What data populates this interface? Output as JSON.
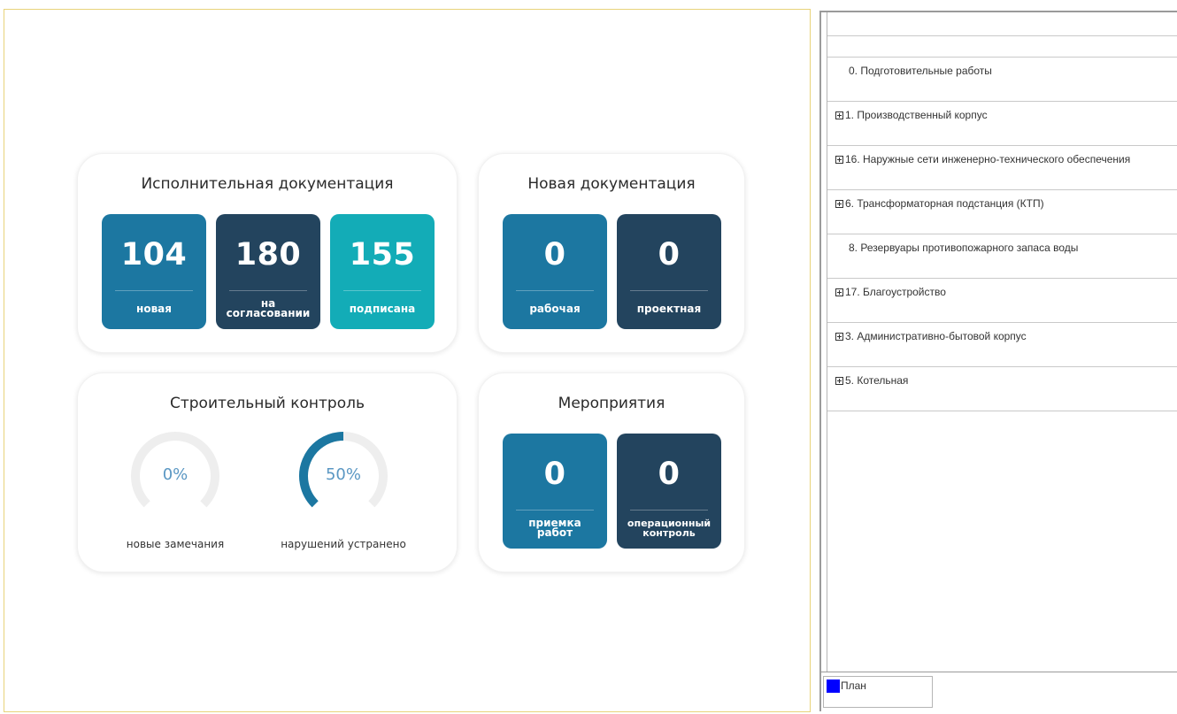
{
  "dashboard": {
    "executive_docs": {
      "title": "Исполнительная документация",
      "tiles": [
        {
          "value": "104",
          "label": "новая"
        },
        {
          "value": "180",
          "label": "на согласовании"
        },
        {
          "value": "155",
          "label": "подписана"
        }
      ]
    },
    "new_docs": {
      "title": "Новая документация",
      "tiles": [
        {
          "value": "0",
          "label": "рабочая"
        },
        {
          "value": "0",
          "label": "проектная"
        }
      ]
    },
    "construction_control": {
      "title": "Строительный контроль",
      "gauges": [
        {
          "percent_text": "0%",
          "fraction": 0.0,
          "caption": "новые замечания"
        },
        {
          "percent_text": "50%",
          "fraction": 0.5,
          "caption": "нарушений устранено"
        }
      ]
    },
    "events": {
      "title": "Мероприятия",
      "tiles": [
        {
          "value": "0",
          "label": "приемка работ"
        },
        {
          "value": "0",
          "label": "операционный контроль"
        }
      ]
    }
  },
  "colors": {
    "tile_blue": "#1c77a1",
    "tile_dark": "#23445e",
    "tile_teal": "#13acb7",
    "gauge_fill": "#1c77a1",
    "gauge_track": "#eeeeee",
    "legend_plan": "#0000ff"
  },
  "tree": {
    "items": [
      {
        "label": "0. Подготовительные работы",
        "expandable": false
      },
      {
        "label": "1. Производственный корпус",
        "expandable": true
      },
      {
        "label": "16. Наружные сети инженерно-технического обеспечения",
        "expandable": true
      },
      {
        "label": "6. Трансформаторная подстанция (КТП)",
        "expandable": true
      },
      {
        "label": "8. Резервуары противопожарного запаса воды",
        "expandable": false
      },
      {
        "label": "17. Благоустройство",
        "expandable": true
      },
      {
        "label": "3. Административно-бытовой корпус",
        "expandable": true
      },
      {
        "label": "5. Котельная",
        "expandable": true
      }
    ]
  },
  "legend": {
    "plan_label": "План"
  }
}
